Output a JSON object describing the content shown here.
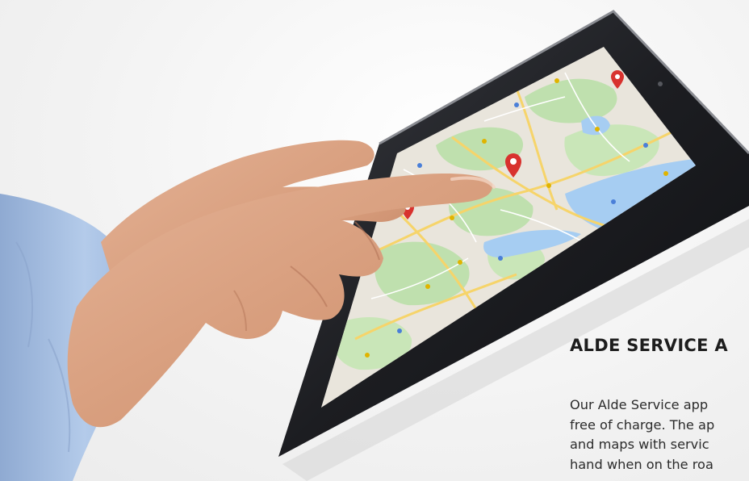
{
  "article": {
    "title": "ALDE SERVICE A",
    "body_lines": [
      "Our Alde Service app",
      "free of charge. The ap",
      "and maps with servic",
      "hand when on the roa"
    ]
  },
  "image": {
    "map_pin_icons": [
      "map-pin-icon",
      "map-pin-icon",
      "map-pin-icon"
    ],
    "colors": {
      "map_land": "#e9e5dc",
      "map_park": "#bfe0ae",
      "map_water": "#a6cdf2",
      "map_road": "#f6d46a",
      "pin_red": "#d8322e",
      "tablet_frame": "#1c1d21",
      "sleeve_blue": "#a9c3e6",
      "skin": "#d99f7f"
    }
  }
}
